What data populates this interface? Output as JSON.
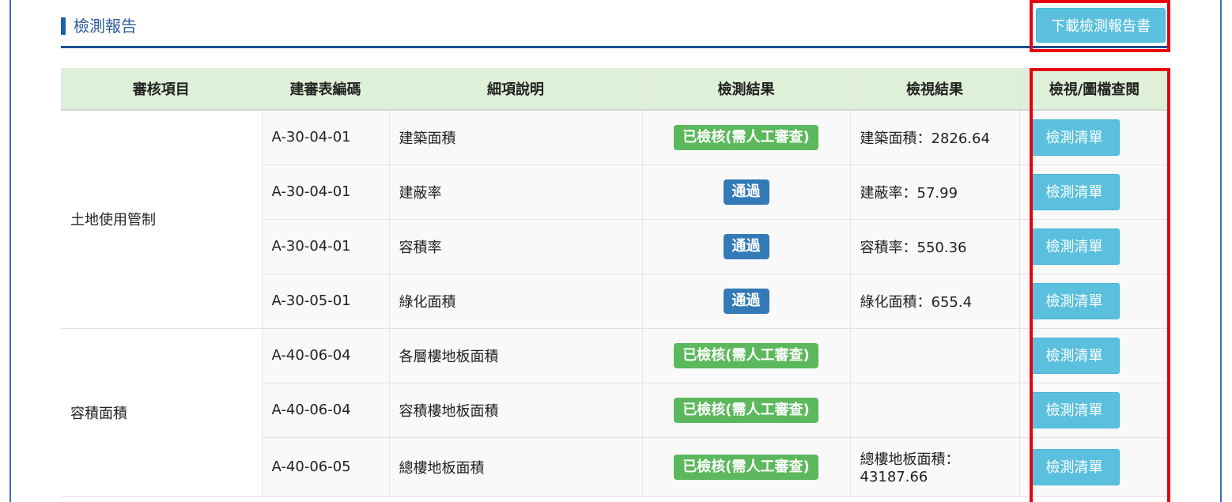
{
  "section": {
    "title": "檢測報告",
    "download_label": "下載檢測報告書"
  },
  "table": {
    "headers": [
      "審核項目",
      "建審表編碼",
      "細項說明",
      "檢測結果",
      "檢視結果",
      "檢視/圖檔查閱"
    ],
    "groups": [
      {
        "category": "土地使用管制",
        "rows": [
          {
            "code": "A-30-04-01",
            "detail": "建築面積",
            "result": "已檢核(需人工審查)",
            "result_type": "ok",
            "view": "建築面積：2826.64",
            "button": "檢測清單"
          },
          {
            "code": "A-30-04-01",
            "detail": "建蔽率",
            "result": "通過",
            "result_type": "pass",
            "view": "建蔽率：57.99",
            "button": "檢測清單"
          },
          {
            "code": "A-30-04-01",
            "detail": "容積率",
            "result": "通過",
            "result_type": "pass",
            "view": "容積率：550.36",
            "button": "檢測清單"
          },
          {
            "code": "A-30-05-01",
            "detail": "綠化面積",
            "result": "通過",
            "result_type": "pass",
            "view": "綠化面積：655.4",
            "button": "檢測清單"
          }
        ]
      },
      {
        "category": "容積面積",
        "rows": [
          {
            "code": "A-40-06-04",
            "detail": "各層樓地板面積",
            "result": "已檢核(需人工審查)",
            "result_type": "ok",
            "view": "",
            "button": "檢測清單"
          },
          {
            "code": "A-40-06-04",
            "detail": "容積樓地板面積",
            "result": "已檢核(需人工審查)",
            "result_type": "ok",
            "view": "",
            "button": "檢測清單"
          },
          {
            "code": "A-40-06-05",
            "detail": "總樓地板面積",
            "result": "已檢核(需人工審查)",
            "result_type": "ok",
            "view_line1": "總樓地板面積：",
            "view_line2": "43187.66",
            "button": "檢測清單"
          }
        ]
      }
    ]
  },
  "colors": {
    "header_bg": "#dff0d8",
    "info_button": "#5bc0de",
    "success_label": "#5cb85c",
    "primary_label": "#337ab7",
    "highlight_border": "#e8000f",
    "title_color": "#2a5d9b"
  }
}
